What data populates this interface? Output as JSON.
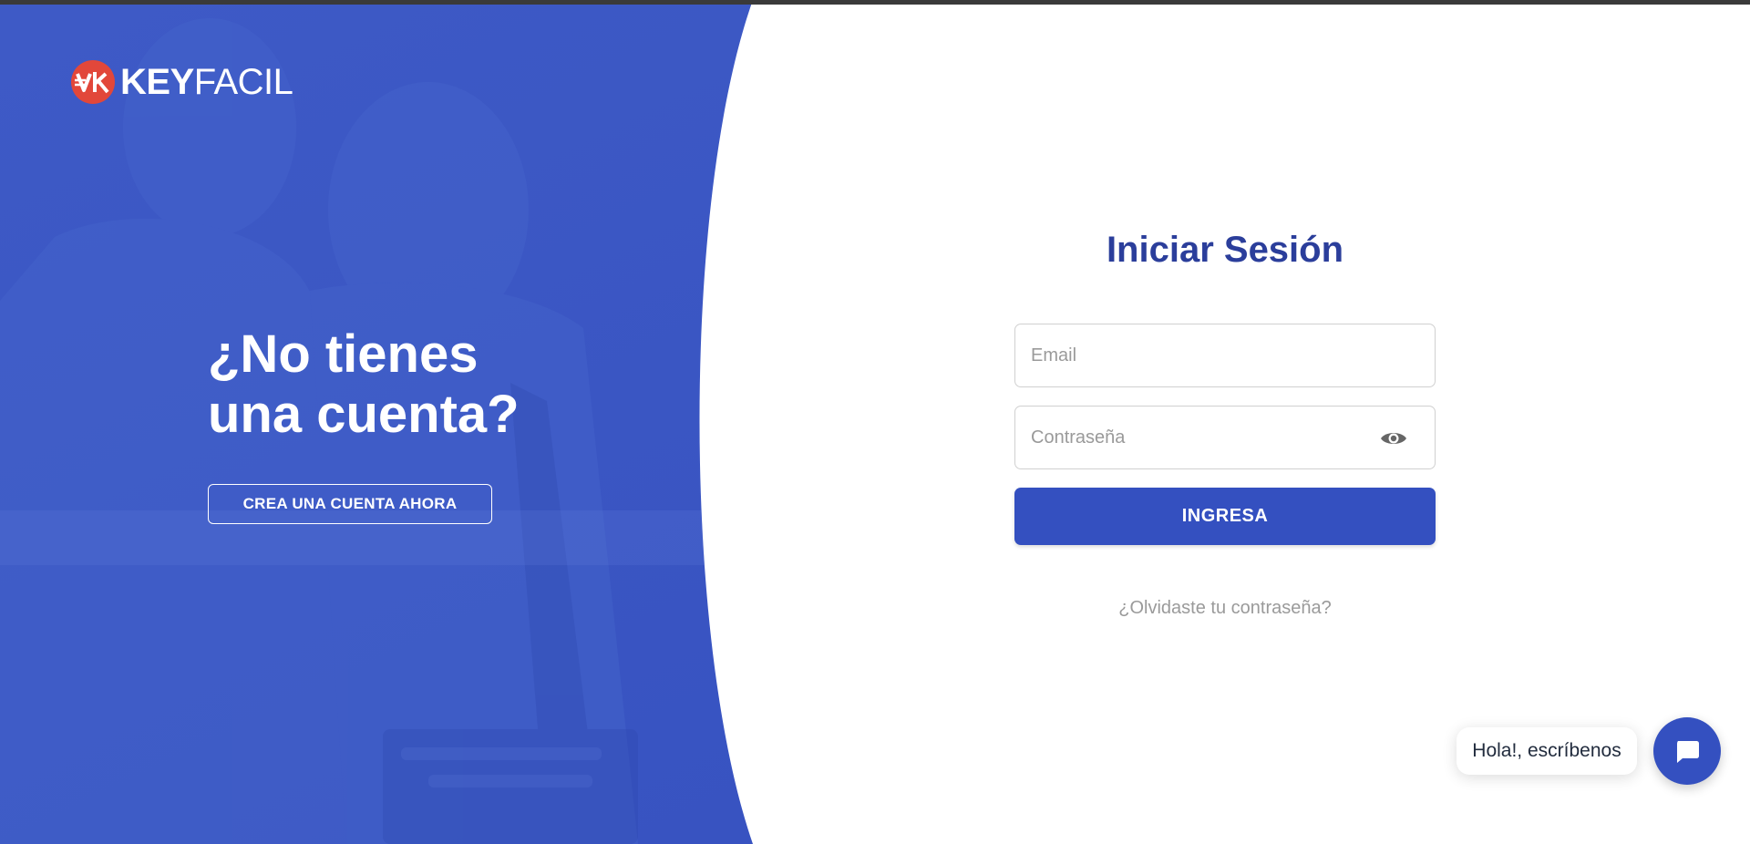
{
  "brand": {
    "logo_mark_text": "VK",
    "name_bold": "KEY",
    "name_light": "FACIL"
  },
  "hero": {
    "title_line_1": "¿No tienes",
    "title_line_2": "una cuenta?",
    "create_account_label": "CREA UNA CUENTA AHORA"
  },
  "login": {
    "title": "Iniciar Sesión",
    "email": {
      "placeholder": "Email",
      "value": ""
    },
    "password": {
      "placeholder": "Contraseña",
      "value": ""
    },
    "submit_label": "INGRESA",
    "forgot_label": "¿Olvidaste tu contraseña?"
  },
  "chat": {
    "bubble_text": "Hola!, escríbenos"
  },
  "colors": {
    "panel_blue": "#3a57c4",
    "title_blue": "#2b3e9b",
    "button_blue": "#3450c0",
    "logo_red": "#e2473a"
  }
}
